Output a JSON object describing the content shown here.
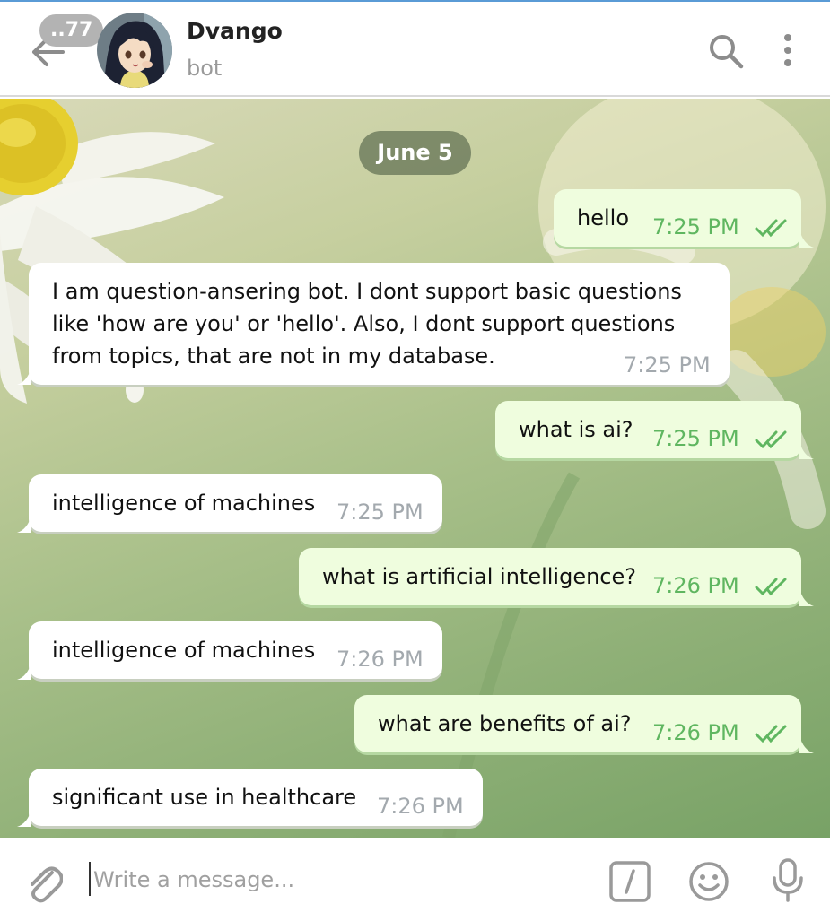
{
  "header": {
    "unread_count": "..77",
    "chat_name": "Dvango",
    "chat_status": "bot"
  },
  "chat": {
    "date": "June 5",
    "messages": [
      {
        "direction": "out",
        "text": "hello",
        "time": "7:25 PM",
        "read": true
      },
      {
        "direction": "in",
        "lines": [
          "I am question-ansering bot. I dont support basic questions",
          "like 'how are you' or 'hello'. Also, I dont support questions",
          "from topics, that are not in my database."
        ],
        "time": "7:25 PM"
      },
      {
        "direction": "out",
        "text": "what is ai?",
        "time": "7:25 PM",
        "read": true
      },
      {
        "direction": "in",
        "text": "intelligence of machines",
        "time": "7:25 PM"
      },
      {
        "direction": "out",
        "text": "what is artificial intelligence?",
        "time": "7:26 PM",
        "read": true
      },
      {
        "direction": "in",
        "text": "intelligence of machines",
        "time": "7:26 PM"
      },
      {
        "direction": "out",
        "text": "what are benefits of ai?",
        "time": "7:26 PM",
        "read": true
      },
      {
        "direction": "in",
        "text": "significant use in healthcare",
        "time": "7:26 PM"
      }
    ]
  },
  "input": {
    "placeholder": "Write a message...",
    "value": ""
  },
  "icons": {
    "back": "arrow-left-icon",
    "search": "search-icon",
    "menu": "more-vertical-icon",
    "attach": "paperclip-icon",
    "commands": "slash-command-icon",
    "emoji": "emoji-icon",
    "mic": "microphone-icon",
    "read_receipt": "double-check-icon"
  },
  "colors": {
    "outgoing_bubble": "#effdde",
    "incoming_bubble": "#ffffff",
    "outgoing_time": "#5fb660",
    "incoming_time": "#a3a9ae",
    "badge": "#b3b3b3"
  }
}
